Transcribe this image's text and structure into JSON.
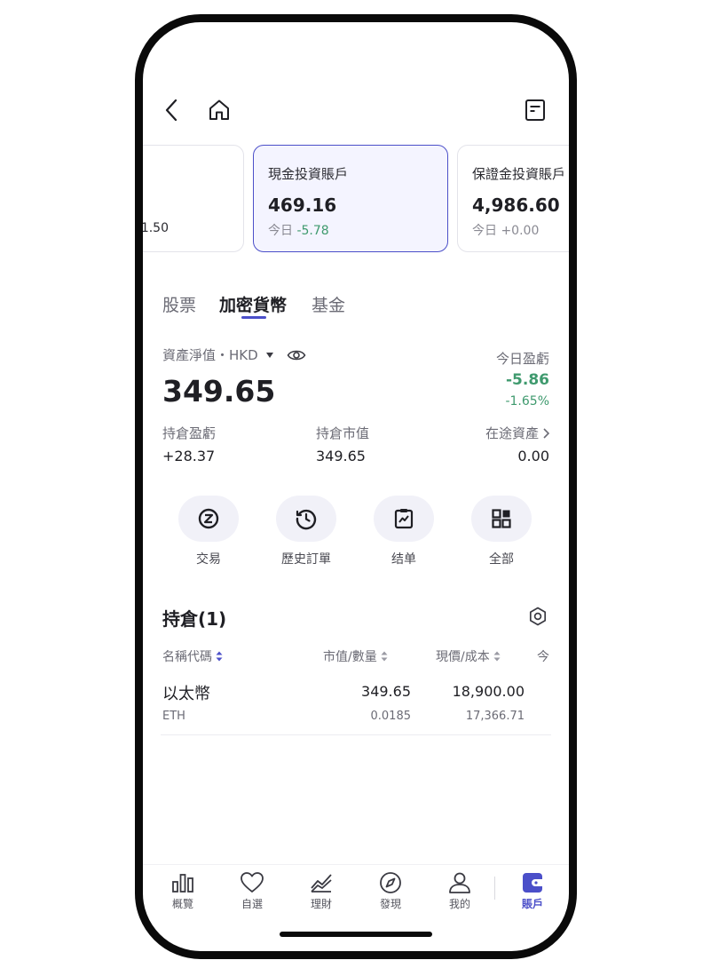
{
  "header": {
    "back_icon": "chevron-left-icon",
    "home_icon": "home-icon",
    "statement_icon": "document-icon"
  },
  "accounts": [
    {
      "name": "",
      "value": "",
      "today_label": "",
      "change": "1.50"
    },
    {
      "name": "現金投資賬戶",
      "value": "469.16",
      "today_label": "今日",
      "change": "-5.78"
    },
    {
      "name": "保證金投資賬戶",
      "value": "4,986.60",
      "today_label": "今日",
      "change": "+0.00"
    }
  ],
  "tabs": [
    {
      "label": "股票"
    },
    {
      "label": "加密貨幣"
    },
    {
      "label": "基金"
    }
  ],
  "summary": {
    "net_asset_label": "資產淨值・HKD",
    "net_asset_value": "349.65",
    "today_pl_label": "今日盈虧",
    "today_pl_value": "-5.86",
    "today_pl_pct": "-1.65%",
    "position_pl_label": "持倉盈虧",
    "position_pl_value": "+28.37",
    "market_value_label": "持倉市值",
    "market_value": "349.65",
    "in_transit_label": "在途資產",
    "in_transit_value": "0.00"
  },
  "actions": [
    {
      "label": "交易",
      "icon": "trade-icon"
    },
    {
      "label": "歷史訂單",
      "icon": "history-clock-icon"
    },
    {
      "label": "结单",
      "icon": "statement-chart-icon"
    },
    {
      "label": "全部",
      "icon": "grid-icon"
    }
  ],
  "positions": {
    "title": "持倉(1)",
    "columns": [
      "名稱代碼",
      "市值/數量",
      "現價/成本",
      "今"
    ],
    "rows": [
      {
        "name": "以太幣",
        "code": "ETH",
        "market_value": "349.65",
        "quantity": "0.0185",
        "price": "18,900.00",
        "cost": "17,366.71"
      }
    ]
  },
  "bottom_nav": [
    {
      "label": "概覽",
      "icon": "bar-chart-icon"
    },
    {
      "label": "自選",
      "icon": "heart-icon"
    },
    {
      "label": "理財",
      "icon": "trend-icon"
    },
    {
      "label": "發現",
      "icon": "compass-icon"
    },
    {
      "label": "我的",
      "icon": "user-icon"
    },
    {
      "label": "賬戶",
      "icon": "wallet-icon"
    }
  ],
  "colors": {
    "accent": "#4b4fc9",
    "gain": "#d6476b",
    "loss": "#3f9a6e"
  }
}
